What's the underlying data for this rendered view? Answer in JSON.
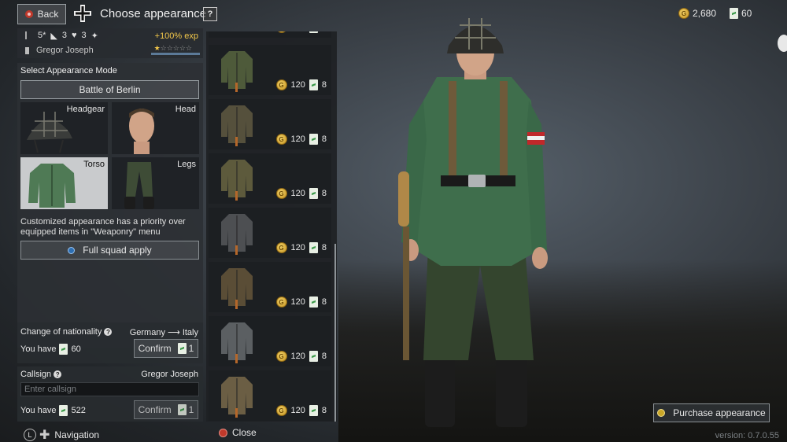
{
  "header": {
    "back_label": "Back",
    "title": "Choose appearance",
    "help_label": "?",
    "gold_amount": "2,680",
    "tickets_amount": "60"
  },
  "soldier": {
    "stats": [
      "5*",
      "3",
      "3"
    ],
    "name": "Gregor Joseph",
    "exp_bonus": "+100% exp",
    "stars_filled": 1,
    "stars_total": 6
  },
  "appearance": {
    "mode_label": "Select Appearance Mode",
    "mode_value": "Battle of Berlin",
    "slots": {
      "headgear": "Headgear",
      "head": "Head",
      "torso": "Torso",
      "legs": "Legs"
    },
    "selected_slot": "Torso",
    "note": "Customized appearance has a priority over equipped items in \"Weaponry\" menu",
    "squad_apply_label": "Full squad apply"
  },
  "nationality": {
    "label": "Change of nationality",
    "route": "Germany ⟶ Italy",
    "you_have_label": "You have",
    "you_have_amount": "60",
    "confirm_label": "Confirm",
    "cost": "1"
  },
  "callsign": {
    "label": "Callsign",
    "current": "Gregor Joseph",
    "placeholder": "Enter callsign",
    "you_have_label": "You have",
    "you_have_amount": "522",
    "confirm_label": "Confirm",
    "cost": "1"
  },
  "items": [
    {
      "gold": "120",
      "tickets": "8",
      "color": "#4e5a3a"
    },
    {
      "gold": "120",
      "tickets": "8",
      "color": "#55503c"
    },
    {
      "gold": "120",
      "tickets": "8",
      "color": "#5d5a3c"
    },
    {
      "gold": "120",
      "tickets": "8",
      "color": "#4d4f52"
    },
    {
      "gold": "120",
      "tickets": "8",
      "color": "#5a4d36"
    },
    {
      "gold": "120",
      "tickets": "8",
      "color": "#5b5f62"
    },
    {
      "gold": "120",
      "tickets": "8",
      "color": "#6b5e44"
    }
  ],
  "partial_item": {
    "gold": "120",
    "tickets": "8"
  },
  "purchase_label": "Purchase appearance",
  "hints": {
    "navigation": "Navigation",
    "close": "Close"
  },
  "version": "version: 0.7.0.55"
}
